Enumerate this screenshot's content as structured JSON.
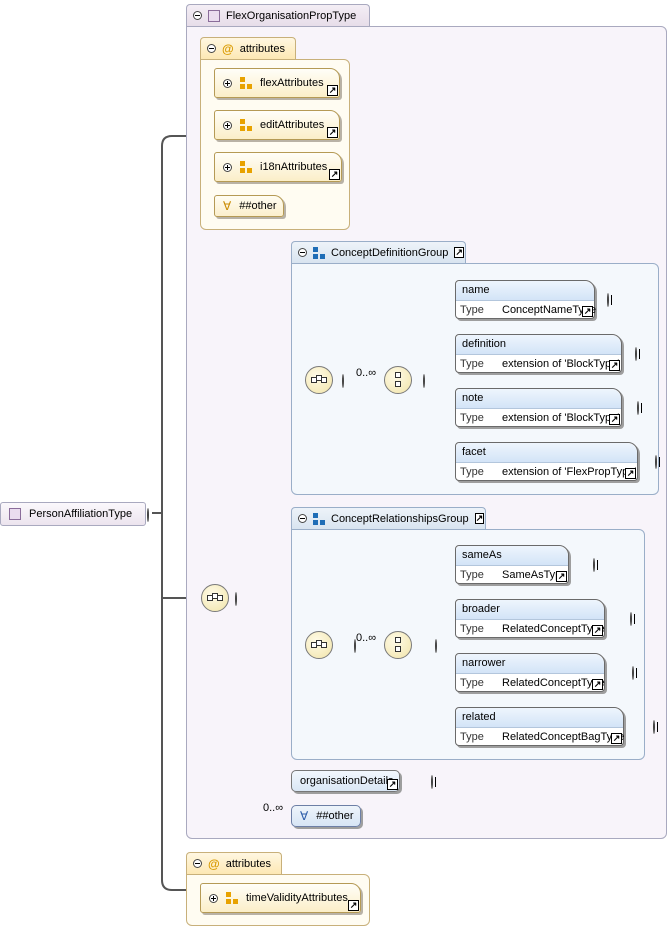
{
  "root": {
    "name": "PersonAffiliationType"
  },
  "base": {
    "name": "FlexOrganisationPropType"
  },
  "attributes1": {
    "label": "attributes",
    "groups": [
      "flexAttributes",
      "editAttributes",
      "i18nAttributes"
    ],
    "any_other": "##other"
  },
  "concept_definition": {
    "group_name": "ConceptDefinitionGroup",
    "occurrence": "0..∞",
    "type_label": "Type",
    "elements": [
      {
        "name": "name",
        "type": "ConceptNameType"
      },
      {
        "name": "definition",
        "type": "extension of 'BlockType'"
      },
      {
        "name": "note",
        "type": "extension of 'BlockType'"
      },
      {
        "name": "facet",
        "type": "extension of 'FlexPropType'"
      }
    ]
  },
  "concept_relationships": {
    "group_name": "ConceptRelationshipsGroup",
    "occurrence": "0..∞",
    "type_label": "Type",
    "elements": [
      {
        "name": "sameAs",
        "type": "SameAsType"
      },
      {
        "name": "broader",
        "type": "RelatedConceptType"
      },
      {
        "name": "narrower",
        "type": "RelatedConceptType"
      },
      {
        "name": "related",
        "type": "RelatedConceptBagType"
      }
    ]
  },
  "organisation_details": {
    "name": "organisationDetails"
  },
  "any_element": {
    "occurrence": "0..∞",
    "label": "##other"
  },
  "attributes2": {
    "label": "attributes",
    "groups": [
      "timeValidityAttributes"
    ]
  },
  "colors": {
    "line": "#555555",
    "thin_line": "#bbbbbb",
    "link_arrow": "#000000"
  }
}
